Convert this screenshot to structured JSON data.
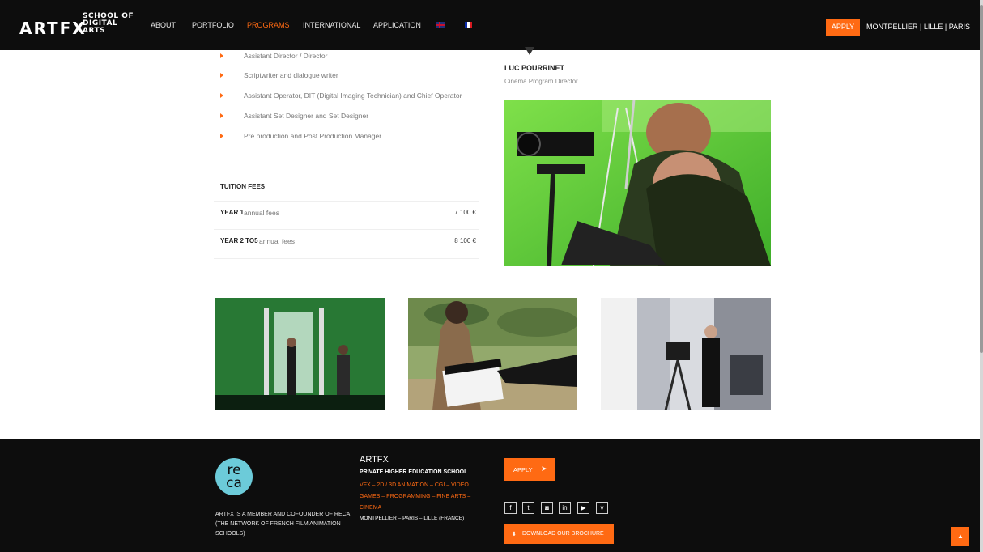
{
  "header": {
    "logo_main": "ARTFX",
    "logo_sub": [
      "SCHOOL OF",
      "DIGITAL",
      "ARTS"
    ],
    "nav": [
      {
        "label": "ABOUT",
        "active": false
      },
      {
        "label": "PORTFOLIO",
        "active": false
      },
      {
        "label": "PROGRAMS",
        "active": true
      },
      {
        "label": "INTERNATIONAL",
        "active": false
      },
      {
        "label": "APPLICATION",
        "active": false
      }
    ],
    "languages": [
      "uk-flag-icon",
      "fr-flag-icon"
    ],
    "apply_label": "APPLY",
    "cities": "MONTPELLIER | LILLE | PARIS"
  },
  "careers": [
    "Assistant Director / Director",
    "Scriptwriter and dialogue writer",
    "Assistant Operator, DIT (Digital Imaging Technician) and Chief Operator",
    "Assistant Set Designer and Set Designer",
    "Pre production and Post Production Manager"
  ],
  "tuition": {
    "title": "TUITION FEES",
    "rows": [
      {
        "year": "YEAR 1",
        "desc": "annual fees",
        "amount": "7 100 €"
      },
      {
        "year": "YEAR 2 TO5",
        "desc": "annual fees",
        "amount": "8 100 €"
      }
    ]
  },
  "director": {
    "name": "LUC POURRINET",
    "role": "Cinema Program Director"
  },
  "footer": {
    "reca_top": "re",
    "reca_bottom": "ca",
    "member_text": "ARTFX IS A MEMBER AND COFOUNDER OF RECA (THE NETWORK OF FRENCH FILM ANIMATION SCHOOLS)",
    "brand": "ARTFX",
    "school_type": "PRIVATE HIGHER EDUCATION SCHOOL",
    "programs": "VFX – 2D / 3D ANIMATION – CGI – VIDEO GAMES – PROGRAMMING – FINE ARTS – CINEMA",
    "location": "MONTPELLIER – PARIS – LILLE (FRANCE)",
    "apply_label": "APPLY",
    "social": [
      {
        "icon": "facebook-icon",
        "glyph": "f"
      },
      {
        "icon": "twitter-icon",
        "glyph": "t"
      },
      {
        "icon": "instagram-icon",
        "glyph": "◙"
      },
      {
        "icon": "linkedin-icon",
        "glyph": "in"
      },
      {
        "icon": "youtube-icon",
        "glyph": "▶"
      },
      {
        "icon": "vimeo-icon",
        "glyph": "v"
      }
    ],
    "brochure_label": "DOWNLOAD OUR BROCHURE"
  },
  "colors": {
    "accent": "#ff6a13",
    "header_bg": "#0d0d0d",
    "reca": "#6ccbd9"
  }
}
